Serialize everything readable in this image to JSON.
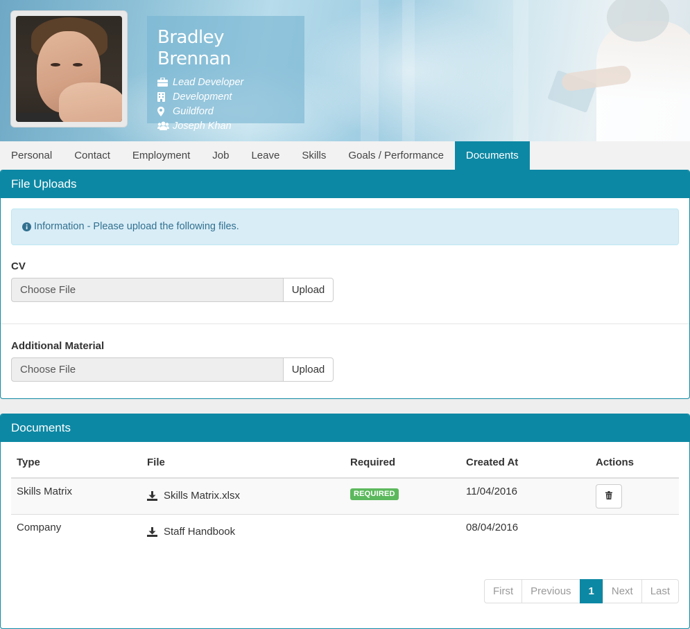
{
  "profile": {
    "name": "Bradley Brennan",
    "role": "Lead Developer",
    "department": "Development",
    "location": "Guildford",
    "manager": "Joseph Khan"
  },
  "tabs": [
    {
      "label": "Personal"
    },
    {
      "label": "Contact"
    },
    {
      "label": "Employment"
    },
    {
      "label": "Job"
    },
    {
      "label": "Leave"
    },
    {
      "label": "Skills"
    },
    {
      "label": "Goals / Performance"
    },
    {
      "label": "Documents",
      "active": true
    }
  ],
  "file_uploads": {
    "title": "File Uploads",
    "info": "Information - Please upload the following files.",
    "fields": [
      {
        "label": "CV",
        "placeholder": "Choose File",
        "button": "Upload"
      },
      {
        "label": "Additional Material",
        "placeholder": "Choose File",
        "button": "Upload"
      }
    ]
  },
  "documents": {
    "title": "Documents",
    "columns": [
      "Type",
      "File",
      "Required",
      "Created At",
      "Actions"
    ],
    "rows": [
      {
        "type": "Skills Matrix",
        "file": "Skills Matrix.xlsx",
        "required": "REQUIRED",
        "created_at": "11/04/2016",
        "deletable": true
      },
      {
        "type": "Company",
        "file": "Staff Handbook",
        "required": "",
        "created_at": "08/04/2016",
        "deletable": false
      }
    ],
    "pagination": {
      "first": "First",
      "previous": "Previous",
      "current": "1",
      "next": "Next",
      "last": "Last"
    }
  },
  "colors": {
    "accent": "#0d88a4",
    "badge_green": "#5cb85c",
    "alert_bg": "#d9edf7",
    "alert_text": "#31708f"
  },
  "icons": {
    "role": "briefcase-icon",
    "department": "building-icon",
    "location": "map-marker-icon",
    "manager": "users-icon",
    "info": "info-circle-icon",
    "download": "download-icon",
    "delete": "trash-icon"
  }
}
